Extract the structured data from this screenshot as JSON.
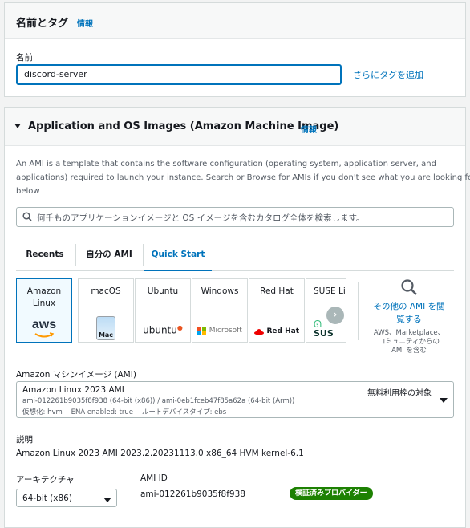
{
  "tags_panel": {
    "title": "名前とタグ",
    "info": "情報",
    "name_label": "名前",
    "name_value": "discord-server",
    "add_tags_link": "さらにタグを追加"
  },
  "ami_panel": {
    "title": "Application and OS Images (Amazon Machine Image)",
    "info": "情報",
    "description": [
      "An AMI is a template that contains the software configuration (operating system, application server, and",
      "applications) required to launch your instance. Search or Browse for AMIs if you don't see what you are looking for",
      "below"
    ],
    "search_placeholder": "何千ものアプリケーションイメージと OS イメージを含むカタログ全体を検索します。",
    "tabs": [
      "Recents",
      "自分の AMI",
      "Quick Start"
    ],
    "active_tab": "Quick Start",
    "os_cards": [
      {
        "label_lines": [
          "Amazon",
          "Linux"
        ],
        "logo_text": "aws",
        "icon": "aws-logo-icon",
        "selected": true
      },
      {
        "label_lines": [
          "macOS"
        ],
        "logo_text": "Mac",
        "icon": "mac-logo-icon",
        "selected": false
      },
      {
        "label_lines": [
          "Ubuntu"
        ],
        "logo_text": "ubuntu",
        "icon": "ubuntu-logo-icon",
        "selected": false
      },
      {
        "label_lines": [
          "Windows"
        ],
        "logo_text": "Microsoft",
        "icon": "microsoft-logo-icon",
        "selected": false
      },
      {
        "label_lines": [
          "Red Hat"
        ],
        "logo_text": "Red Hat",
        "icon": "redhat-logo-icon",
        "selected": false
      },
      {
        "label_lines": [
          "SUSE Li"
        ],
        "logo_text": "SUS",
        "icon": "suse-logo-icon",
        "selected": false
      }
    ],
    "more_amis": {
      "link_line1": "その他の AMI を閲",
      "link_line2": "覧する",
      "sub_line1": "AWS、Marketplace、",
      "sub_line2": "コミュニティからの",
      "sub_line3": "AMI を含む"
    },
    "ami_select_label": "Amazon マシンイメージ (AMI)",
    "ami": {
      "name": "Amazon Linux 2023 AMI",
      "ids": "ami-012261b9035f8f938 (64-bit (x86)) / ami-0eb1fceb47f85a62a (64-bit (Arm))",
      "details": "仮想化: hvm    ENA enabled: true    ルートデバイスタイプ: ebs",
      "free_tier": "無料利用枠の対象"
    },
    "description_label": "説明",
    "description_value": "Amazon Linux 2023 AMI 2023.2.20231113.0 x86_64 HVM kernel-6.1",
    "arch_label": "アーキテクチャ",
    "arch_value": "64-bit (x86)",
    "ami_id_label": "AMI ID",
    "ami_id_value": "ami-012261b9035f8f938",
    "verified_badge": "検証済みプロバイダー"
  },
  "colors": {
    "link": "#0073bb",
    "badge": "#1d8102",
    "border": "#d5dbdb",
    "selected_card_bg": "#f1faff"
  }
}
